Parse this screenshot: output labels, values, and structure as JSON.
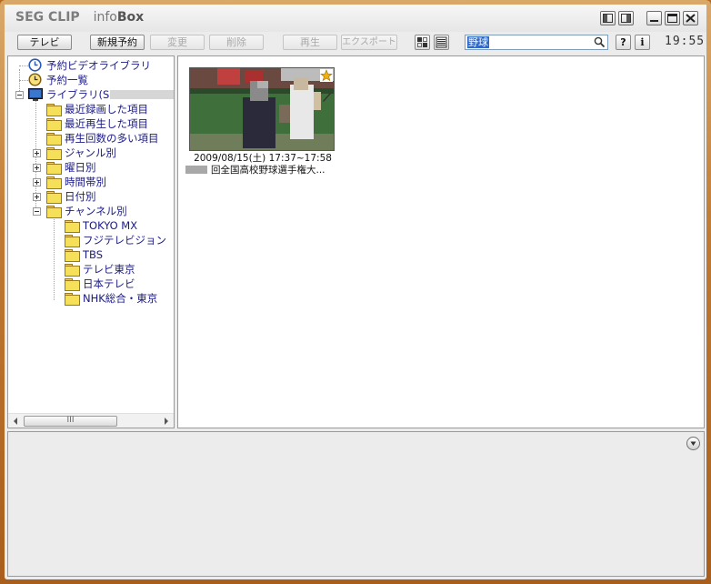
{
  "app": {
    "logo_main": "SEG CLIP",
    "logo_info": "info",
    "logo_box": "Box",
    "clock": "19:55"
  },
  "toolbar": {
    "tv_label": "テレビ",
    "new_reservation_label": "新規予約",
    "change_label": "変更",
    "delete_label": "削除",
    "play_label": "再生",
    "export_label": "エクスポート",
    "help_label": "?",
    "info_label": "i",
    "search_value": "野球"
  },
  "tree": {
    "items": [
      {
        "label": "予約ビデオライブラリ"
      },
      {
        "label": "予約一覧"
      },
      {
        "label": "ライブラリ(SC"
      },
      {
        "label": "最近録画した項目"
      },
      {
        "label": "最近再生した項目"
      },
      {
        "label": "再生回数の多い項目"
      },
      {
        "label": "ジャンル別"
      },
      {
        "label": "曜日別"
      },
      {
        "label": "時間帯別"
      },
      {
        "label": "日付別"
      },
      {
        "label": "チャンネル別"
      },
      {
        "label": "TOKYO  MX"
      },
      {
        "label": "フジテレビジョン"
      },
      {
        "label": "TBS"
      },
      {
        "label": "テレビ東京"
      },
      {
        "label": "日本テレビ"
      },
      {
        "label": "NHK総合・東京"
      }
    ],
    "scroll_grip": "III"
  },
  "recording": {
    "datetime": "2009/08/15(土) 17:37~17:58",
    "title": "回全国高校野球選手権大..."
  },
  "colors": {
    "frame": "#b86a22",
    "tree_text": "#1a1a86",
    "selection": "#3169c6"
  }
}
